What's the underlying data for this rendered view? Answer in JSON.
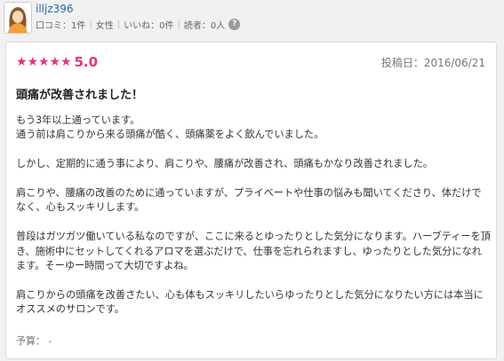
{
  "user": {
    "name": "illjz396",
    "meta": [
      "口コミ：1件",
      "女性",
      "いいね：0件",
      "読者：0人"
    ],
    "help": "?"
  },
  "review": {
    "star_count": 5,
    "star_color": "#e0357f",
    "score": "5.0",
    "posted": "投稿日：2016/06/21",
    "title": "頭痛が改善されました！",
    "paragraphs": [
      "もう3年以上通っています。\n通う前は肩こりから来る頭痛が酷く、頭痛薬をよく飲んでいました。",
      "しかし、定期的に通う事により、肩こりや、腰痛が改善され、頭痛もかなり改善されました。",
      "肩こりや、腰痛の改善のために通っていますが、プライベートや仕事の悩みも聞いてくださり、体だけでなく、心もスッキリします。",
      "普段はガツガツ働いている私なのですが、ここに来るとゆったりとした気分になります。ハーブティーを頂き、施術中にセットしてくれるアロマを選ぶだけで、仕事を忘れられますし、ゆったりとした気分になれます。そーゆー時間って大切ですよね。",
      "肩こりからの頭痛を改善さたい、心も体もスッキリしたいらゆったりとした気分になりたい方には本当にオススメのサロンです。"
    ],
    "budget_label": "予算：",
    "budget_value": "-"
  }
}
